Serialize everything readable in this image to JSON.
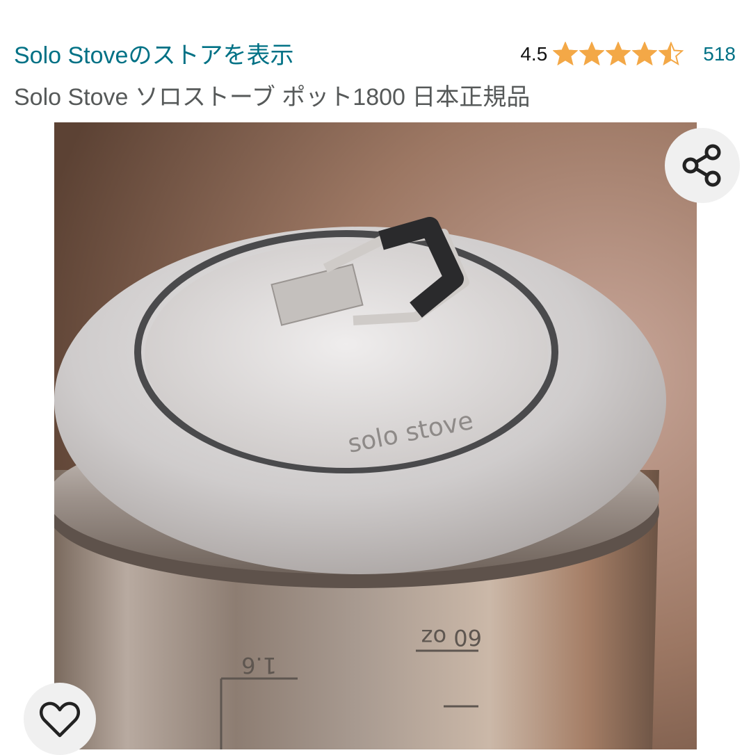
{
  "store": {
    "link_text": "Solo Stoveのストアを表示"
  },
  "rating": {
    "value_text": "4.5",
    "value": 4.5,
    "max": 5,
    "review_count": "518",
    "star_color": "#f3a847"
  },
  "product": {
    "title": "Solo Stove ソロストーブ ポット1800 日本正規品",
    "image": {
      "lid_logo_text": "solo stove",
      "measure_oz_text": "60 oz",
      "measure_l_text": "1.6"
    }
  },
  "icons": {
    "share": "share-icon",
    "favorite": "heart-outline-icon"
  },
  "colors": {
    "link": "#007185",
    "title": "#565959",
    "text": "#111111"
  }
}
